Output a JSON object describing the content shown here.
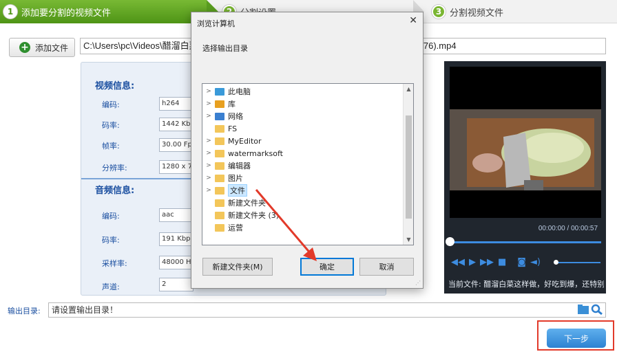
{
  "steps": [
    {
      "num": "1",
      "label": "添加要分割的视频文件"
    },
    {
      "num": "2",
      "label": "分割设置"
    },
    {
      "num": "3",
      "label": "分割视频文件"
    }
  ],
  "toolbar": {
    "add_file_label": "添加文件",
    "file_path_left": "C:\\Users\\pc\\Videos\\醋溜白菜",
    "file_path_right": "00037.785-000129.376).mp4"
  },
  "video_info": {
    "title": "视频信息:",
    "rows": [
      {
        "label": "编码:",
        "value": "h264"
      },
      {
        "label": "码率:",
        "value": "1442 Kbps"
      },
      {
        "label": "帧率:",
        "value": "30.00 Fps"
      },
      {
        "label": "分辨率:",
        "value": "1280 x 720"
      }
    ]
  },
  "audio_info": {
    "title": "音频信息:",
    "rows": [
      {
        "label": "编码:",
        "value": "aac"
      },
      {
        "label": "码率:",
        "value": "191 Kbps"
      },
      {
        "label": "采样率:",
        "value": "48000 HZ"
      },
      {
        "label": "声道:",
        "value": "2"
      }
    ]
  },
  "player": {
    "time": "00:00:00 / 00:00:57",
    "current_file": "当前文件: 醋溜白菜这样做，好吃到爆，还特别",
    "playback_progress": 0
  },
  "output": {
    "label": "输出目录:",
    "value": "请设置输出目录！"
  },
  "next_label": "下一步",
  "dialog": {
    "title": "浏览计算机",
    "close": "✕",
    "header": "选择输出目录",
    "tree": [
      {
        "label": "此电脑",
        "arrow": ">",
        "icon": "computer-icon",
        "color": "#3a9ad9"
      },
      {
        "label": "库",
        "arrow": ">",
        "icon": "library-icon",
        "color": "#e8a020"
      },
      {
        "label": "网络",
        "arrow": ">",
        "icon": "network-icon",
        "color": "#3a7fd0"
      },
      {
        "label": "FS",
        "arrow": "",
        "icon": "folder-icon",
        "color": "#f3c65a"
      },
      {
        "label": "MyEditor",
        "arrow": ">",
        "icon": "folder-icon",
        "color": "#f3c65a"
      },
      {
        "label": "watermarksoft",
        "arrow": ">",
        "icon": "folder-icon",
        "color": "#f3c65a"
      },
      {
        "label": "编辑器",
        "arrow": ">",
        "icon": "folder-icon",
        "color": "#f3c65a"
      },
      {
        "label": "图片",
        "arrow": ">",
        "icon": "folder-icon",
        "color": "#f3c65a"
      },
      {
        "label": "文件",
        "arrow": ">",
        "icon": "folder-icon",
        "color": "#f3c65a",
        "selected": true
      },
      {
        "label": "新建文件夹",
        "arrow": "",
        "icon": "folder-icon",
        "color": "#f3c65a"
      },
      {
        "label": "新建文件夹 (3)",
        "arrow": "",
        "icon": "folder-icon",
        "color": "#f3c65a"
      },
      {
        "label": "运营",
        "arrow": "",
        "icon": "folder-icon",
        "color": "#f3c65a"
      }
    ],
    "new_folder_label": "新建文件夹(M)",
    "ok_label": "确定",
    "cancel_label": "取消"
  },
  "colors": {
    "accent_green": "#4e9416",
    "label_blue": "#1b4fa0",
    "annotation_red": "#e23a2a",
    "dialog_ok_border": "#0078d7"
  }
}
